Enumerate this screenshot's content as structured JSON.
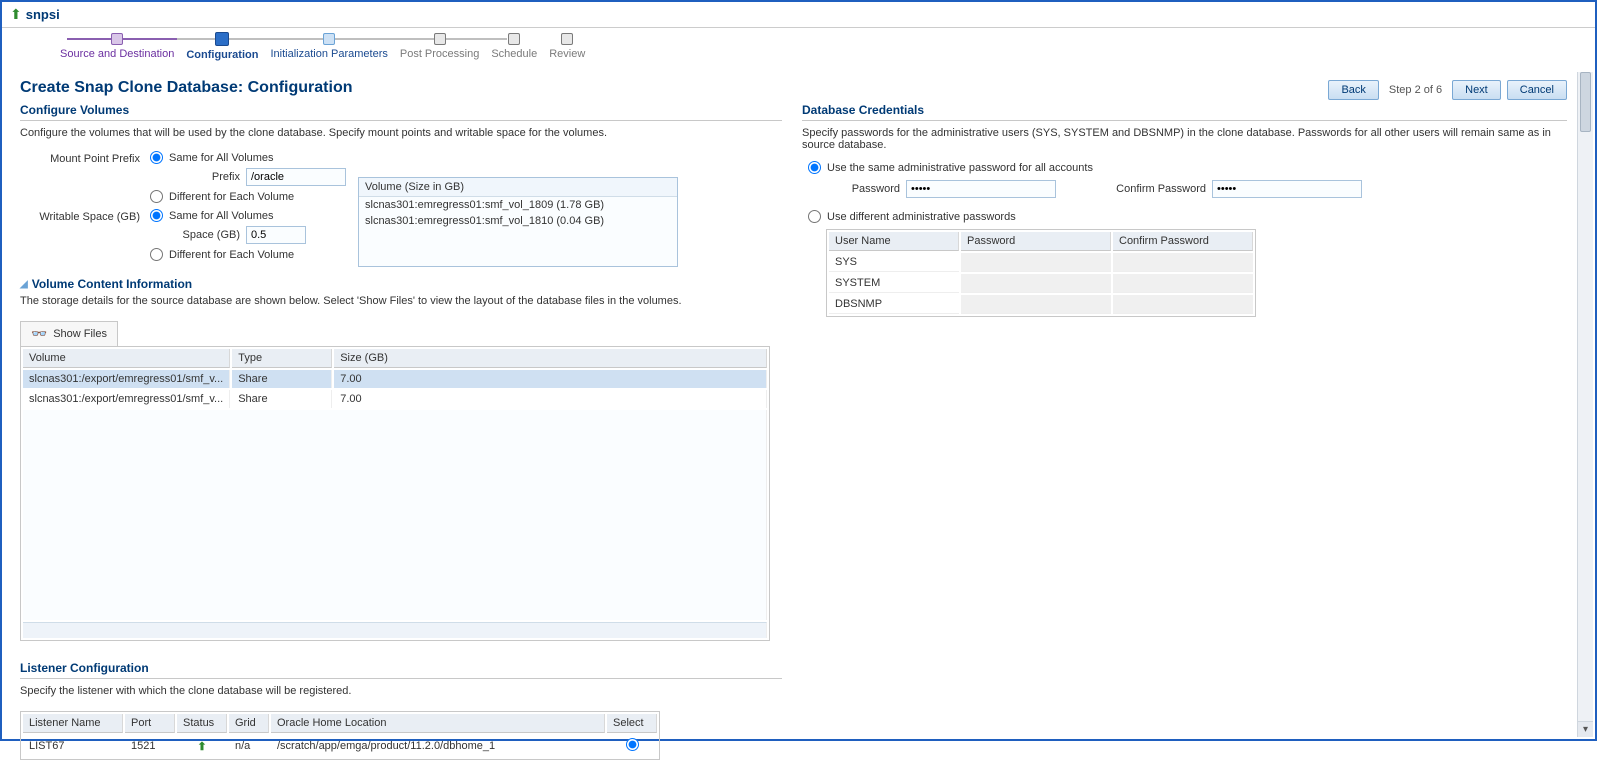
{
  "header": {
    "db_name": "snpsi"
  },
  "train": {
    "steps": [
      {
        "label": "Source and Destination",
        "state": "done"
      },
      {
        "label": "Configuration",
        "state": "active"
      },
      {
        "label": "Initialization Parameters",
        "state": "avail"
      },
      {
        "label": "Post Processing",
        "state": "dis"
      },
      {
        "label": "Schedule",
        "state": "dis"
      },
      {
        "label": "Review",
        "state": "dis"
      }
    ]
  },
  "actions": {
    "back": "Back",
    "step_indicator": "Step 2 of 6",
    "next": "Next",
    "cancel": "Cancel"
  },
  "page_title": "Create Snap Clone Database: Configuration",
  "configure_volumes": {
    "title": "Configure Volumes",
    "desc": "Configure the volumes that will be used by the clone database. Specify mount points and writable space for the volumes.",
    "mount_point_label": "Mount Point Prefix",
    "mount_opt_same": "Same for All Volumes",
    "mount_opt_diff": "Different for Each Volume",
    "prefix_label": "Prefix",
    "prefix_value": "/oracle",
    "writable_label": "Writable Space (GB)",
    "writable_opt_same": "Same for All Volumes",
    "writable_opt_diff": "Different for Each Volume",
    "space_label": "Space (GB)",
    "space_value": "0.5",
    "volume_header": "Volume (Size in GB)",
    "volumes": [
      "slcnas301:emregress01:smf_vol_1809 (1.78 GB)",
      "slcnas301:emregress01:smf_vol_1810 (0.04 GB)"
    ]
  },
  "volume_content": {
    "title": "Volume Content Information",
    "desc": "The storage details for the source database are shown below. Select 'Show Files' to view the layout of the database files in the volumes.",
    "show_files": "Show Files",
    "columns": {
      "volume": "Volume",
      "type": "Type",
      "size": "Size (GB)"
    },
    "rows": [
      {
        "volume": "slcnas301:/export/emregress01/smf_v...",
        "type": "Share",
        "size": "7.00",
        "selected": true
      },
      {
        "volume": "slcnas301:/export/emregress01/smf_v...",
        "type": "Share",
        "size": "7.00",
        "selected": false
      }
    ]
  },
  "listener": {
    "title": "Listener Configuration",
    "desc": "Specify the listener with which the clone database will be registered.",
    "columns": {
      "name": "Listener Name",
      "port": "Port",
      "status": "Status",
      "grid": "Grid",
      "home": "Oracle Home Location",
      "select": "Select"
    },
    "rows": [
      {
        "name": "LIST67",
        "port": "1521",
        "status": "up",
        "grid": "n/a",
        "home": "/scratch/app/emga/product/11.2.0/dbhome_1",
        "selected": true
      }
    ]
  },
  "credentials": {
    "title": "Database Credentials",
    "desc": "Specify passwords for the administrative users (SYS, SYSTEM and DBSNMP) in the clone database. Passwords for all other users will remain same as in source database.",
    "opt_same": "Use the same administrative password for all accounts",
    "opt_diff": "Use different administrative passwords",
    "password_label": "Password",
    "confirm_label": "Confirm Password",
    "password_value": "•••••",
    "confirm_value": "•••••",
    "table_cols": {
      "user": "User Name",
      "pw": "Password",
      "cpw": "Confirm Password"
    },
    "users": [
      "SYS",
      "SYSTEM",
      "DBSNMP"
    ]
  }
}
